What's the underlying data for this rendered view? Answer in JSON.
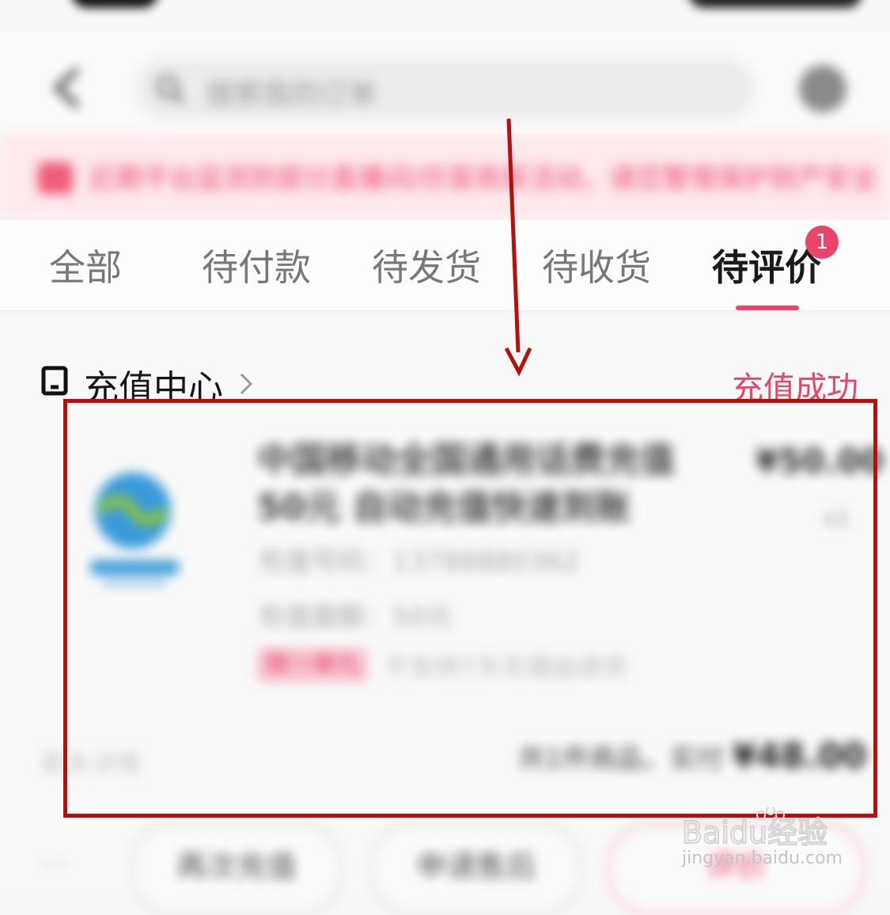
{
  "search": {
    "placeholder": "搜索我的订单"
  },
  "notice": {
    "text": "近期平台监测到部分直播间/仿冒商家活动，请您警惕保护财产安全"
  },
  "tabs": [
    {
      "label": "全部"
    },
    {
      "label": "待付款"
    },
    {
      "label": "待发货"
    },
    {
      "label": "待收货"
    },
    {
      "label": "待评价",
      "badge": "1",
      "active": true
    }
  ],
  "order": {
    "store_name": "充值中心",
    "status": "充值成功",
    "product_title": "中国移动全国通用话费充值 50元 自动充值快速到账",
    "price": "¥50.00",
    "quantity": "x1",
    "spec_phone": "充值号码：13788880362",
    "spec_amount": "充值面额：50元",
    "promo_tag": "限一单九",
    "promo_text": "不支持7天无理由退货",
    "left_note": "更多详情",
    "total_prefix": "共1件商品，实付",
    "total_amount": "¥48.00",
    "actions": {
      "more": "···",
      "recharge_again": "再次充值",
      "after_sale": "申请售后",
      "review": "评价"
    }
  },
  "watermark": {
    "brand": "Baidu经验",
    "url": "jingyan.baidu.com"
  },
  "colors": {
    "accent": "#e8456b",
    "annotation": "#b3100f"
  }
}
